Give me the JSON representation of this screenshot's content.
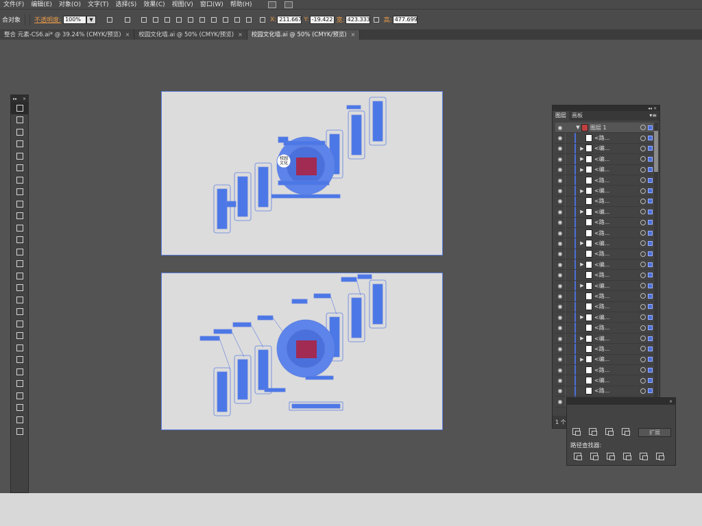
{
  "menu": [
    "文件(F)",
    "编辑(E)",
    "对象(O)",
    "文字(T)",
    "选择(S)",
    "效果(C)",
    "视图(V)",
    "窗口(W)",
    "帮助(H)"
  ],
  "control": {
    "group_label": "合对象",
    "opacity_label": "不透明度:",
    "opacity_value": "100%",
    "x_label": "X:",
    "x_value": "211.667",
    "y_label": "Y:",
    "y_value": "-19.422",
    "w_label": "宽:",
    "w_value": "423.333",
    "h_label": "高:",
    "h_value": "477.699"
  },
  "tabs": [
    {
      "label": "整合 元素-CS6.ai* @ 39.24% (CMYK/预览)",
      "active": false
    },
    {
      "label": "校园文化墙.ai @ 50% (CMYK/预览)",
      "active": false
    },
    {
      "label": "校园文化墙.ai @ 50% (CMYK/预览)",
      "active": true
    }
  ],
  "close_glyph": "×",
  "tools": [
    "selection",
    "direct-selection",
    "magic-wand",
    "lasso",
    "pen",
    "type",
    "line",
    "rectangle",
    "paintbrush",
    "pencil",
    "blob-brush",
    "eraser",
    "rotate",
    "scale",
    "width",
    "free-transform",
    "shape-builder",
    "perspective-grid",
    "mesh",
    "gradient",
    "eyedropper",
    "blend",
    "symbol-sprayer",
    "column-graph",
    "artboard",
    "slice",
    "hand",
    "zoom"
  ],
  "layers_panel": {
    "tab_layers": "图层",
    "tab_artboards": "画板",
    "layer_name": "图层 1",
    "count_label": "1 个图层",
    "rows": [
      {
        "name": "<路...",
        "expand": false
      },
      {
        "name": "<编...",
        "expand": true
      },
      {
        "name": "<编...",
        "expand": true
      },
      {
        "name": "<编...",
        "expand": true
      },
      {
        "name": "<路...",
        "expand": false
      },
      {
        "name": "<编...",
        "expand": true
      },
      {
        "name": "<路...",
        "expand": false
      },
      {
        "name": "<编...",
        "expand": true
      },
      {
        "name": "<路...",
        "expand": false
      },
      {
        "name": "<路...",
        "expand": false
      },
      {
        "name": "<编...",
        "expand": true
      },
      {
        "name": "<路...",
        "expand": false
      },
      {
        "name": "<编...",
        "expand": true
      },
      {
        "name": "<路...",
        "expand": false
      },
      {
        "name": "<编...",
        "expand": true
      },
      {
        "name": "<路...",
        "expand": false
      },
      {
        "name": "<路...",
        "expand": false
      },
      {
        "name": "<编...",
        "expand": true
      },
      {
        "name": "<路...",
        "expand": false
      },
      {
        "name": "<编...",
        "expand": true
      },
      {
        "name": "<路...",
        "expand": false
      },
      {
        "name": "<编...",
        "expand": true
      },
      {
        "name": "<路...",
        "expand": false
      },
      {
        "name": "<编...",
        "expand": false
      },
      {
        "name": "<路...",
        "expand": false
      },
      {
        "name": "<路...",
        "expand": false
      }
    ]
  },
  "pathfinder": {
    "title": "路径查找器:",
    "expand_label": "扩展"
  },
  "artwork": {
    "sign_text_1": "校园",
    "sign_text_2": "文化"
  },
  "colors": {
    "selection_blue": "#5f7fe0",
    "art_blue": "#4b78e6",
    "art_red": "#b01e3a"
  }
}
